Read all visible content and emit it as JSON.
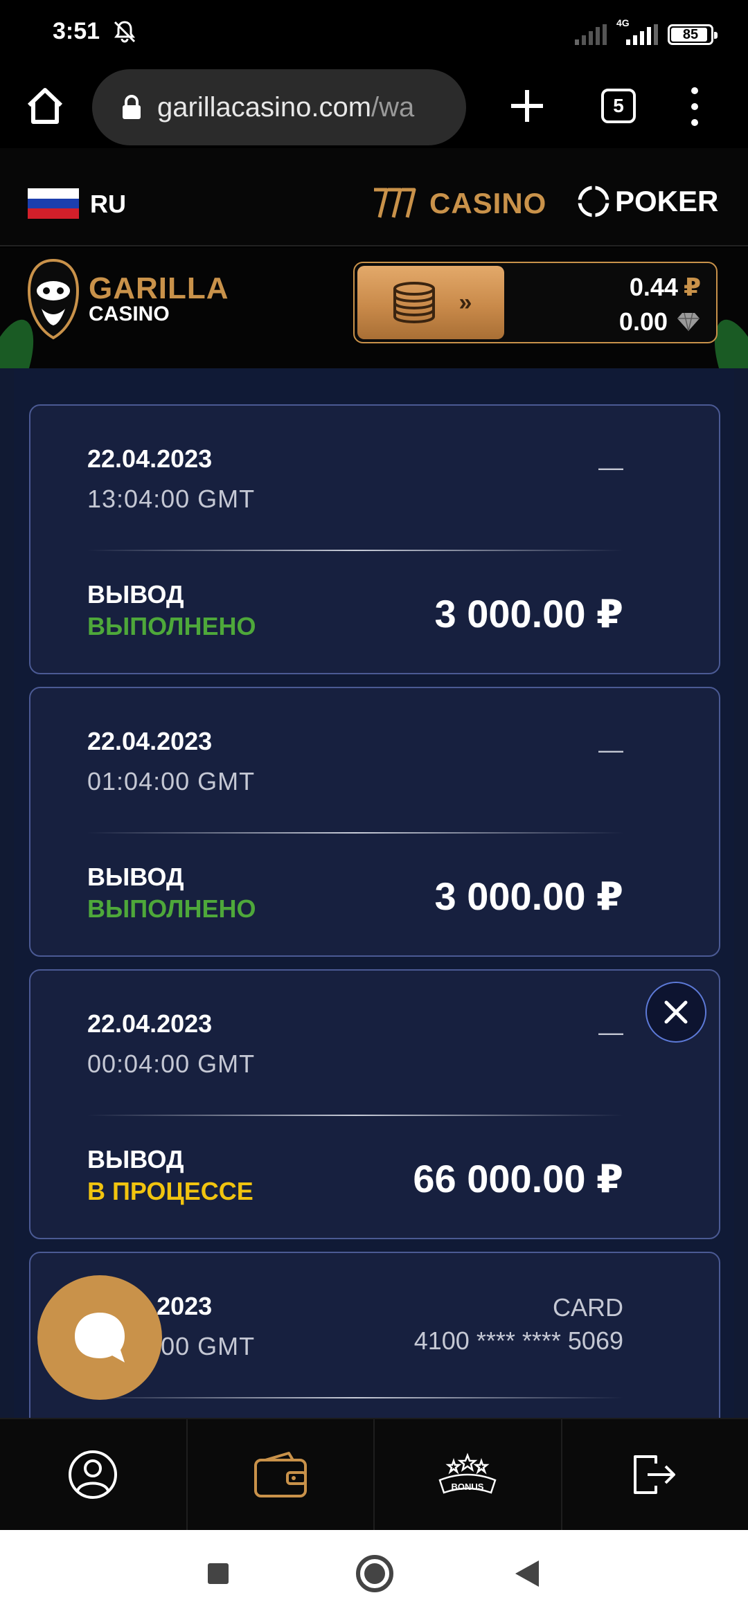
{
  "status_bar": {
    "time": "3:51",
    "network": "4G",
    "battery": "85"
  },
  "browser": {
    "url_host": "garillacasino.com",
    "url_path": "/wa",
    "tab_count": "5"
  },
  "top_nav": {
    "language": "RU",
    "casino_label": "CASINO",
    "poker_label": "POKER"
  },
  "header": {
    "logo_title": "GARILLA",
    "logo_subtitle": "CASINO",
    "balance_main": "0.44",
    "balance_main_currency": "₽",
    "balance_bonus": "0.00"
  },
  "transactions": [
    {
      "date": "22.04.2023",
      "time": "13:04:00 GMT",
      "method": "—",
      "type": "ВЫВОД",
      "status": "ВЫПОЛНЕНО",
      "amount": "3 000.00 ₽"
    },
    {
      "date": "22.04.2023",
      "time": "01:04:00 GMT",
      "method": "—",
      "type": "ВЫВОД",
      "status": "ВЫПОЛНЕНО",
      "amount": "3 000.00 ₽"
    },
    {
      "date": "22.04.2023",
      "time": "00:04:00 GMT",
      "method": "—",
      "type": "ВЫВОД",
      "status": "В ПРОЦЕССЕ",
      "amount": "66 000.00 ₽"
    },
    {
      "date": "22.04.2023",
      "time": "00:00:00 GMT",
      "method_label": "CARD",
      "method_number": "4100 **** **** 5069"
    }
  ],
  "bottom_nav": {
    "bonus_label": "BONUS"
  },
  "colors": {
    "gold": "#c9924a",
    "done_green": "#4ea83a",
    "pending_yellow": "#f1c40f",
    "card_bg": "#17203f",
    "card_border": "#4b5a94"
  },
  "icons": [
    "home-icon",
    "lock-icon",
    "plus-icon",
    "menu-dots-icon",
    "slot-777-icon",
    "poker-chip-icon",
    "gorilla-logo-icon",
    "coins-icon",
    "diamond-icon",
    "close-icon",
    "chat-icon",
    "user-icon",
    "wallet-icon",
    "bonus-icon",
    "logout-icon",
    "bell-muted-icon"
  ]
}
